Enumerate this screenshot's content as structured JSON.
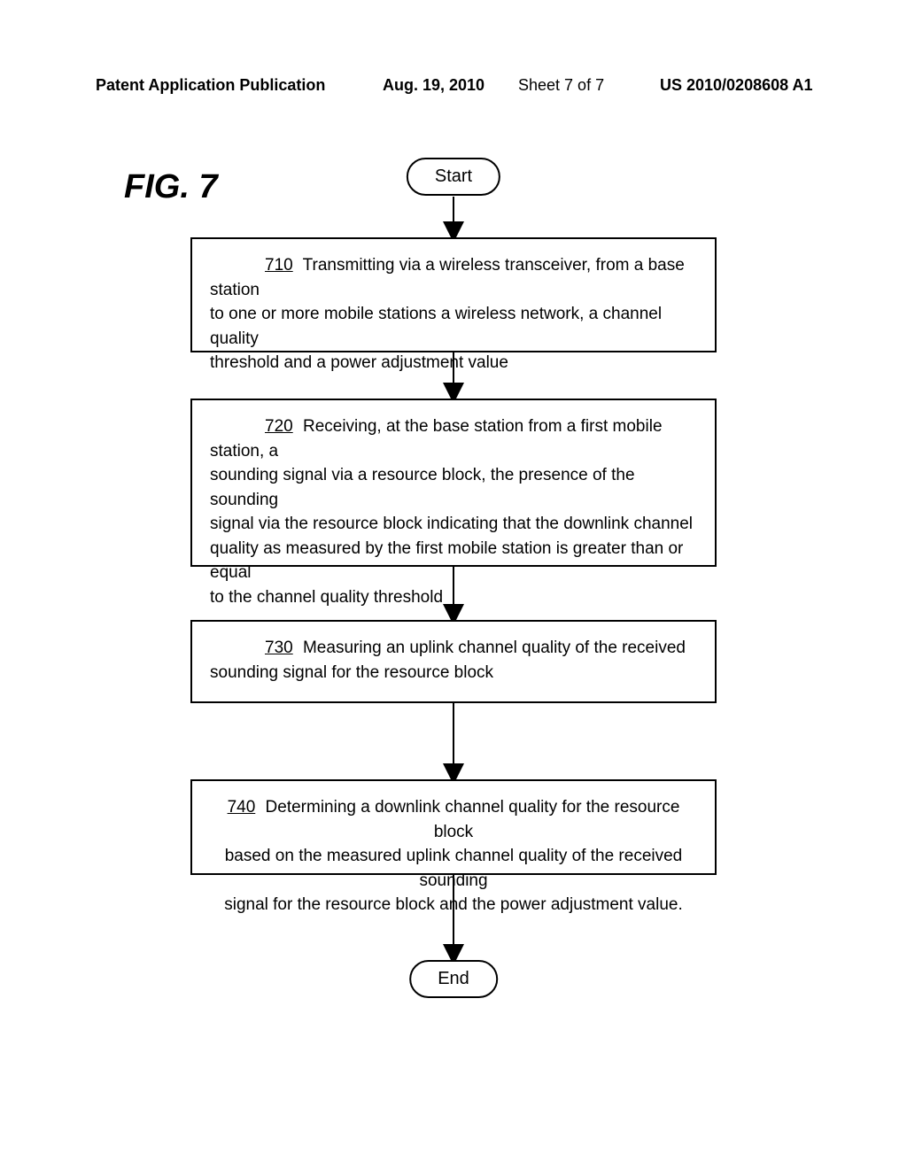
{
  "header": {
    "publication": "Patent Application Publication",
    "date": "Aug. 19, 2010",
    "sheet": "Sheet 7 of 7",
    "docnum": "US 2010/0208608 A1"
  },
  "figure_label": "FIG. 7",
  "terminals": {
    "start": "Start",
    "end": "End"
  },
  "steps": {
    "s710": {
      "num": "710",
      "line1": "Transmitting via a wireless transceiver, from a base station",
      "line2": "to one or more mobile stations a wireless network, a channel quality",
      "line3": "threshold and a power adjustment value"
    },
    "s720": {
      "num": "720",
      "line1": "Receiving, at the base station from a first mobile station, a",
      "line2": "sounding signal via a resource block, the presence of the sounding",
      "line3": "signal via the resource block indicating that the downlink channel",
      "line4": "quality as measured by the first mobile station is greater than or equal",
      "line5": "to the channel quality threshold"
    },
    "s730": {
      "num": "730",
      "line1": "Measuring an uplink channel quality of the received",
      "line2": "sounding signal for the resource block"
    },
    "s740": {
      "num": "740",
      "line1": "Determining a downlink channel quality for the resource block",
      "line2": "based on the measured uplink channel quality of the received sounding",
      "line3": "signal for the resource block and the power adjustment value."
    }
  },
  "chart_data": {
    "type": "flowchart",
    "nodes": [
      {
        "id": "start",
        "type": "terminal",
        "label": "Start"
      },
      {
        "id": "710",
        "type": "process",
        "label": "Transmitting via a wireless transceiver, from a base station to one or more mobile stations a wireless network, a channel quality threshold and a power adjustment value"
      },
      {
        "id": "720",
        "type": "process",
        "label": "Receiving, at the base station from a first mobile station, a sounding signal via a resource block, the presence of the sounding signal via the resource block indicating that the downlink channel quality as measured by the first mobile station is greater than or equal to the channel quality threshold"
      },
      {
        "id": "730",
        "type": "process",
        "label": "Measuring an uplink channel quality of the received sounding signal for the resource block"
      },
      {
        "id": "740",
        "type": "process",
        "label": "Determining a downlink channel quality for the resource block based on the measured uplink channel quality of the received sounding signal for the resource block and the power adjustment value."
      },
      {
        "id": "end",
        "type": "terminal",
        "label": "End"
      }
    ],
    "edges": [
      {
        "from": "start",
        "to": "710"
      },
      {
        "from": "710",
        "to": "720"
      },
      {
        "from": "720",
        "to": "730"
      },
      {
        "from": "730",
        "to": "740"
      },
      {
        "from": "740",
        "to": "end"
      }
    ]
  }
}
